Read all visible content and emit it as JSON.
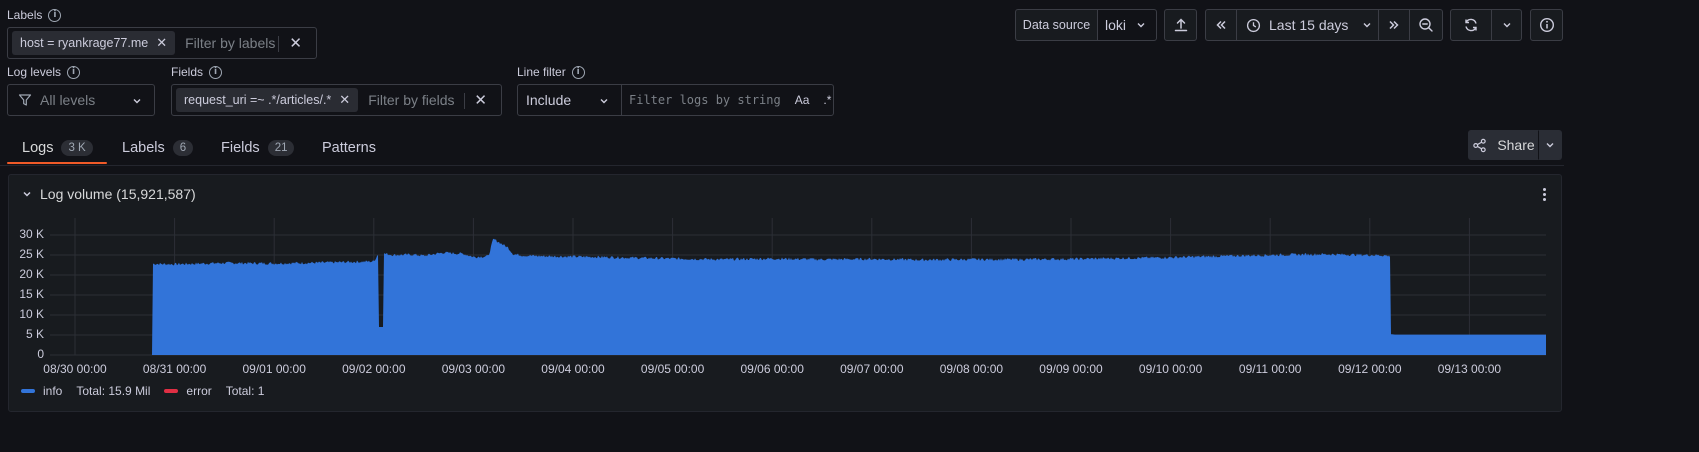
{
  "colors": {
    "background": "#111217",
    "panel": "#181b1f",
    "info_series": "#3274d9",
    "error_series": "#e02f44",
    "active_tab_underline": "#f05a28"
  },
  "labels_section": {
    "title": "Labels",
    "chip": "host = ryankrage77.me",
    "placeholder": "Filter by labels"
  },
  "log_levels": {
    "title": "Log levels",
    "value": "All levels"
  },
  "fields_section": {
    "title": "Fields",
    "chip": "request_uri =~ .*/articles/.*",
    "placeholder": "Filter by fields"
  },
  "line_filter": {
    "title": "Line filter",
    "mode": "Include",
    "placeholder": "Filter logs by string",
    "case_toggle": "Aa",
    "regex_toggle": ".*"
  },
  "toolbar": {
    "datasource_label": "Data source",
    "datasource_value": "loki",
    "time_range": "Last 15 days",
    "icons": [
      "upload-icon",
      "chevrons-left-icon",
      "clock-icon",
      "chevrons-right-icon",
      "zoom-out-icon",
      "refresh-icon",
      "chevron-down-icon",
      "info-icon"
    ]
  },
  "tabs": [
    {
      "label": "Logs",
      "count": "3 K"
    },
    {
      "label": "Labels",
      "count": "6"
    },
    {
      "label": "Fields",
      "count": "21"
    },
    {
      "label": "Patterns",
      "count": ""
    }
  ],
  "share": {
    "label": "Share"
  },
  "panel": {
    "title": "Log volume (15,921,587)"
  },
  "chart_data": {
    "type": "area",
    "y_ticks": [
      "30 K",
      "25 K",
      "20 K",
      "15 K",
      "10 K",
      "5 K",
      "0"
    ],
    "x_ticks": [
      "08/30 00:00",
      "08/31 00:00",
      "09/01 00:00",
      "09/02 00:00",
      "09/03 00:00",
      "09/04 00:00",
      "09/05 00:00",
      "09/06 00:00",
      "09/07 00:00",
      "09/08 00:00",
      "09/09 00:00",
      "09/10 00:00",
      "09/11 00:00",
      "09/12 00:00",
      "09/13 00:00"
    ],
    "ylim": [
      0,
      30000
    ],
    "grid": true,
    "legend_placement": "bottom-left",
    "series": [
      {
        "name": "info",
        "total": "Total: 15.9 Mil",
        "x_days": [
          0.77,
          0.78,
          1.0,
          1.5,
          2.0,
          2.5,
          3.0,
          3.05,
          3.06,
          3.12,
          3.2,
          3.4,
          3.5,
          3.7,
          3.9,
          4.0,
          4.15,
          4.2,
          4.25,
          4.35,
          4.4,
          4.5,
          4.7,
          5.0,
          5.3,
          5.6,
          6.0,
          6.5,
          7.0,
          7.5,
          8.0,
          8.5,
          9.0,
          9.5,
          10.0,
          10.5,
          11.0,
          11.5,
          12.0,
          12.5,
          13.0,
          13.15,
          13.2,
          13.22,
          13.25,
          13.5,
          13.7
        ],
        "values": [
          0,
          22800,
          22700,
          23000,
          22900,
          23100,
          23400,
          25500,
          25400,
          25300,
          25000,
          25100,
          24800,
          25600,
          25300,
          24500,
          24700,
          29000,
          28300,
          26800,
          25200,
          24900,
          24700,
          24600,
          24500,
          24300,
          24100,
          23900,
          24100,
          23900,
          24000,
          23800,
          23900,
          23900,
          24000,
          24200,
          24400,
          24700,
          25000,
          25200,
          25000,
          24900,
          24700,
          5200,
          5100,
          5100,
          5100
        ]
      },
      {
        "name": "error",
        "total": "Total: 1"
      }
    ]
  }
}
